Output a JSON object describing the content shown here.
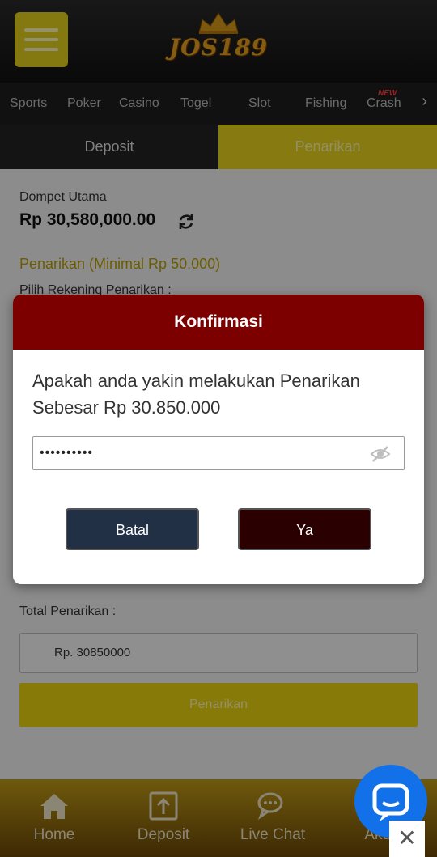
{
  "header": {
    "brand": "JOS189",
    "menu_icon": "hamburger-icon"
  },
  "nav": {
    "items": [
      "Sports",
      "Poker",
      "Casino",
      "Togel",
      "Slot",
      "Fishing",
      "Crash"
    ],
    "new_tag": "NEW",
    "more_icon": "chevron-right-icon"
  },
  "tabs": {
    "deposit": "Deposit",
    "penarikan": "Penarikan",
    "active": "Penarikan"
  },
  "form": {
    "wallet_label": "Dompet Utama",
    "wallet_amount": "Rp 30,580,000.00",
    "section_title": "Penarikan (Minimal Rp 50.000)",
    "pick_label": "Pilih Rekening Penarikan :",
    "total_label": "Total Penarikan :",
    "total_value": "Rp. 30850000",
    "submit_label": "Penarikan"
  },
  "modal": {
    "title": "Konfirmasi",
    "message": "Apakah anda yakin melakukan Penarikan Sebesar Rp 30.850.000",
    "password_value": "••••••••••",
    "cancel_label": "Batal",
    "ok_label": "Ya"
  },
  "bottombar": {
    "items": [
      "Home",
      "Deposit",
      "Live Chat",
      "Akun"
    ]
  },
  "colors": {
    "accent_yellow": "#e7d21c",
    "modal_header": "#7d0000",
    "chat_blue": "#1270e8"
  }
}
